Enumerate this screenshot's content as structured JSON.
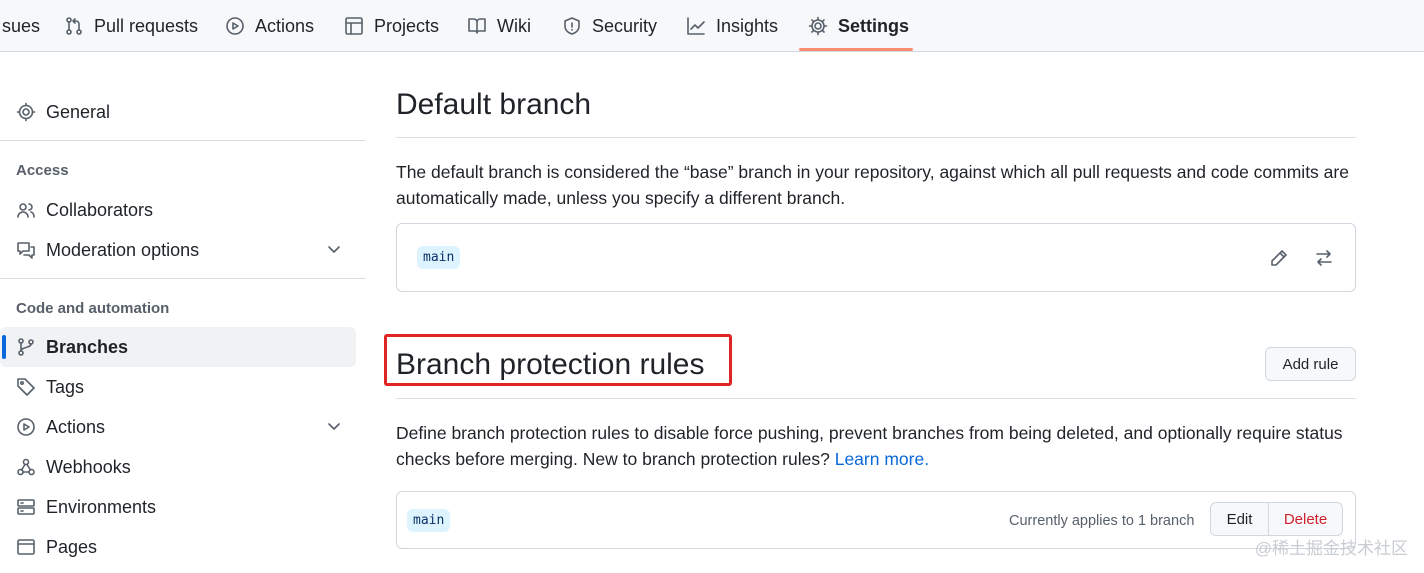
{
  "topnav": {
    "items": [
      {
        "label": "sues",
        "icon": "issue-icon"
      },
      {
        "label": "Pull requests",
        "icon": "git-pull-request-icon"
      },
      {
        "label": "Actions",
        "icon": "play-icon"
      },
      {
        "label": "Projects",
        "icon": "table-icon"
      },
      {
        "label": "Wiki",
        "icon": "book-icon"
      },
      {
        "label": "Security",
        "icon": "shield-icon"
      },
      {
        "label": "Insights",
        "icon": "graph-icon"
      },
      {
        "label": "Settings",
        "icon": "gear-icon",
        "active": true
      }
    ],
    "accent_color": "#fd8c73"
  },
  "sidebar": {
    "general": "General",
    "access_heading": "Access",
    "access_items": [
      "Collaborators",
      "Moderation options"
    ],
    "code_heading": "Code and automation",
    "code_items": [
      "Branches",
      "Tags",
      "Actions",
      "Webhooks",
      "Environments",
      "Pages"
    ],
    "active_item": "Branches"
  },
  "default_branch": {
    "title": "Default branch",
    "description": "The default branch is considered the “base” branch in your repository, against which all pull requests and code commits are automatically made, unless you specify a different branch.",
    "branch": "main"
  },
  "protection": {
    "title": "Branch protection rules",
    "add_rule": "Add rule",
    "description": "Define branch protection rules to disable force pushing, prevent branches from being deleted, and optionally require status checks before merging. New to branch protection rules?",
    "learn_more": "Learn more.",
    "rule_branch": "main",
    "applies": "Currently applies to 1 branch",
    "edit": "Edit",
    "delete": "Delete",
    "delete_color": "#cf222e",
    "highlight_color": "#e02424"
  },
  "watermark": "@稀土掘金技术社区"
}
